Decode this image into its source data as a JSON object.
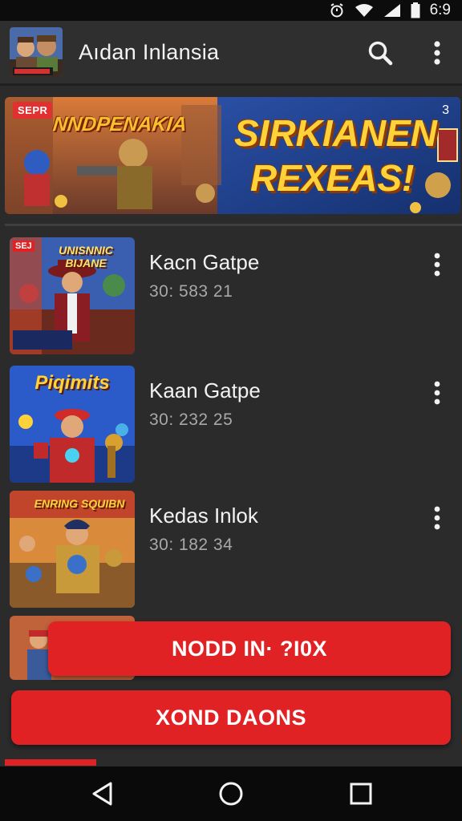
{
  "status_bar": {
    "time": "6:9"
  },
  "app_bar": {
    "title": "Aıdan Inlansia"
  },
  "banner": {
    "badge": "SEPR",
    "left_title": "NNDPENAKIA",
    "right_title_line1": "SIRKIANEN",
    "right_title_line2": "REXEAS!",
    "corner_number": "3"
  },
  "games": [
    {
      "title": "Kacn Gatpe",
      "subtitle": "30: 583 21",
      "thumb_caption": "UNISNNIC BIJANE",
      "thumb_badge": "SEJ"
    },
    {
      "title": "Kaan Gatpe",
      "subtitle": "30: 232 25",
      "thumb_caption": "Piqimits",
      "thumb_badge": ""
    },
    {
      "title": "Kedas Inlok",
      "subtitle": "30: 182 34",
      "thumb_caption": "ENRING SQUIBN",
      "thumb_badge": ""
    }
  ],
  "buttons": {
    "primary": "NODD IN· ?I0X",
    "secondary": "XOND DAONS"
  },
  "colors": {
    "accent_red": "#e02225",
    "background": "#2b2b2b",
    "banner_gold": "#ffd23a"
  }
}
